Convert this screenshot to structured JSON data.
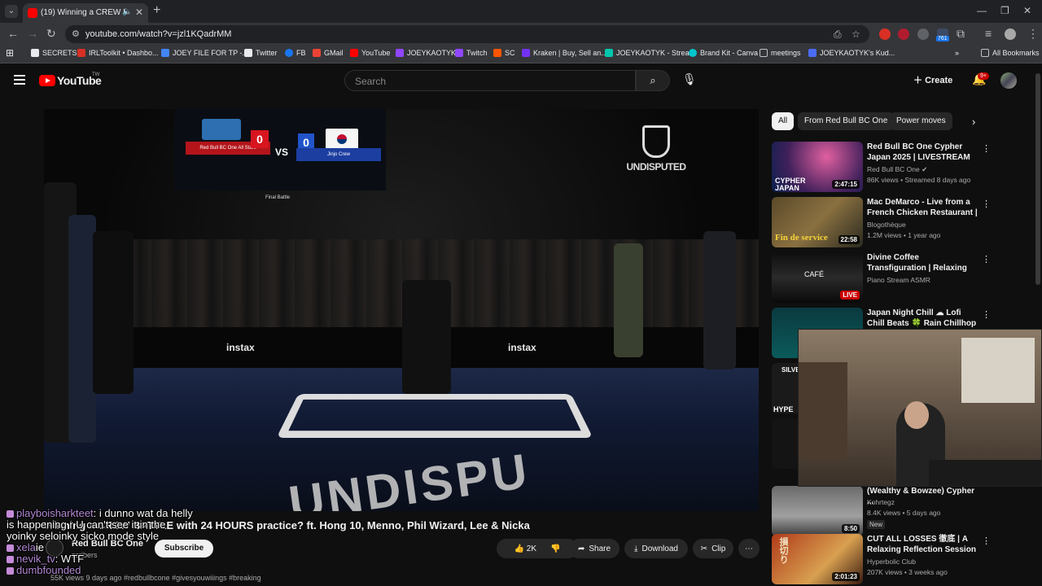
{
  "browser": {
    "tab_title": "(19) Winning a CREW BATTL",
    "url": "youtube.com/watch?v=jzl1KQadrMM",
    "ext_badge": "761",
    "bookmarks": [
      {
        "label": "SECRETS",
        "color": "#e8eaed"
      },
      {
        "label": "IRLToolkit • Dashbo...",
        "color": "#d93025"
      },
      {
        "label": "JOEY FILE FOR TP -...",
        "color": "#4285f4"
      },
      {
        "label": "Twitter",
        "color": "#e8eaed"
      },
      {
        "label": "FB",
        "color": "#1877f2"
      },
      {
        "label": "GMail",
        "color": "#ea4335"
      },
      {
        "label": "YouTube",
        "color": "#ff0000"
      },
      {
        "label": "JOEYKAOTYK",
        "color": "#9146ff"
      },
      {
        "label": "Twitch",
        "color": "#9146ff"
      },
      {
        "label": "SC",
        "color": "#ff5500"
      },
      {
        "label": "Kraken | Buy, Sell an...",
        "color": "#7132f5"
      },
      {
        "label": "JOEYKAOTYK - Strea...",
        "color": "#00c7ac"
      },
      {
        "label": "Brand Kit - Canva",
        "color": "#00c4cc"
      },
      {
        "label": "meetings",
        "color": "#bdc1c6"
      },
      {
        "label": "JOEYKAOTYK's Kud...",
        "color": "#4a6cf7"
      }
    ],
    "all_bookmarks": "All Bookmarks"
  },
  "youtube": {
    "logo_text": "YouTube",
    "logo_tm": "TW",
    "search_placeholder": "Search",
    "create_label": "Create",
    "notif_count": "9+"
  },
  "player": {
    "scoreboard": {
      "team_left": "Red Bull BC One All Stars",
      "team_right": "Jinjo Crew",
      "score_left": "0",
      "score_right": "0",
      "vs": "VS",
      "round": "Final Battle"
    },
    "stage_logo": "UNDISPUTED",
    "sponsor": "instax",
    "floor_text": "UNDISPU"
  },
  "video": {
    "title": "Winning a CREW BATTLE with 24 HOURS practice? ft. Hong 10, Menno, Phil Wizard, Lee & Nicka",
    "channel": "Red Bull BC One",
    "subs": "scribers",
    "subscribe": "Subscribe",
    "likes": "2K",
    "share": "Share",
    "download": "Download",
    "clip": "Clip",
    "desc": "55K views  9 days ago  #redbullbcone #givesyouwiiings #breaking"
  },
  "chat": [
    {
      "user": "playboisharkteet",
      "text": ": i dunno wat da helly"
    },
    {
      "user": "",
      "text": "is happening r U can't see it in the"
    },
    {
      "user": "",
      "text": "yoinky seloinky sicko mode style"
    },
    {
      "user": "xela",
      "text": "ie"
    },
    {
      "user": "nevik_tv",
      "text": ": WTF"
    },
    {
      "user": "dumbfounded",
      "text": ""
    }
  ],
  "sidebar": {
    "chips": [
      "All",
      "From Red Bull BC One",
      "Power moves"
    ],
    "recs": [
      {
        "title": "Red Bull BC One Cypher Japan 2025 | LIVESTREAM",
        "channel": "Red Bull BC One",
        "meta": "86K views • Streamed 8 days ago",
        "duration": "2:47:15",
        "thumb_text": "CYPHER JAPAN"
      },
      {
        "title": "Mac DeMarco - Live from a French Chicken Restaurant | Fi...",
        "channel": "Blogothèque",
        "meta": "1.2M views • 1 year ago",
        "duration": "22:58",
        "thumb_text": "Fin de service"
      },
      {
        "title": "Divine Coffee Transfiguration | Relaxing Jazz Music That ...",
        "channel": "Piano Stream ASMR",
        "meta": "",
        "duration": "LIVE",
        "thumb_text": "CAFÉ"
      },
      {
        "title": "Japan Night Chill ☁ Lofi Chill Beats 🍀 Rain Chillhop Mix to ...",
        "channel": "",
        "meta": "",
        "duration": "",
        "thumb_text": ""
      },
      {
        "title": "(Wealthy & Bowzee) Cypher ...",
        "channel": "Kohrtegz",
        "meta": "8.4K views • 5 days ago",
        "duration": "8:50",
        "thumb_text": ""
      },
      {
        "title": "CUT ALL LOSSES 徹底 | A Relaxing Reflection Session | ...",
        "channel": "Hyperbolic Club",
        "meta": "207K views • 3 weeks ago",
        "duration": "2:01:23",
        "thumb_text": "損切り"
      }
    ],
    "new_badge": "New",
    "hidden_thumb_texts": [
      "SILVE",
      "HYPE"
    ]
  }
}
